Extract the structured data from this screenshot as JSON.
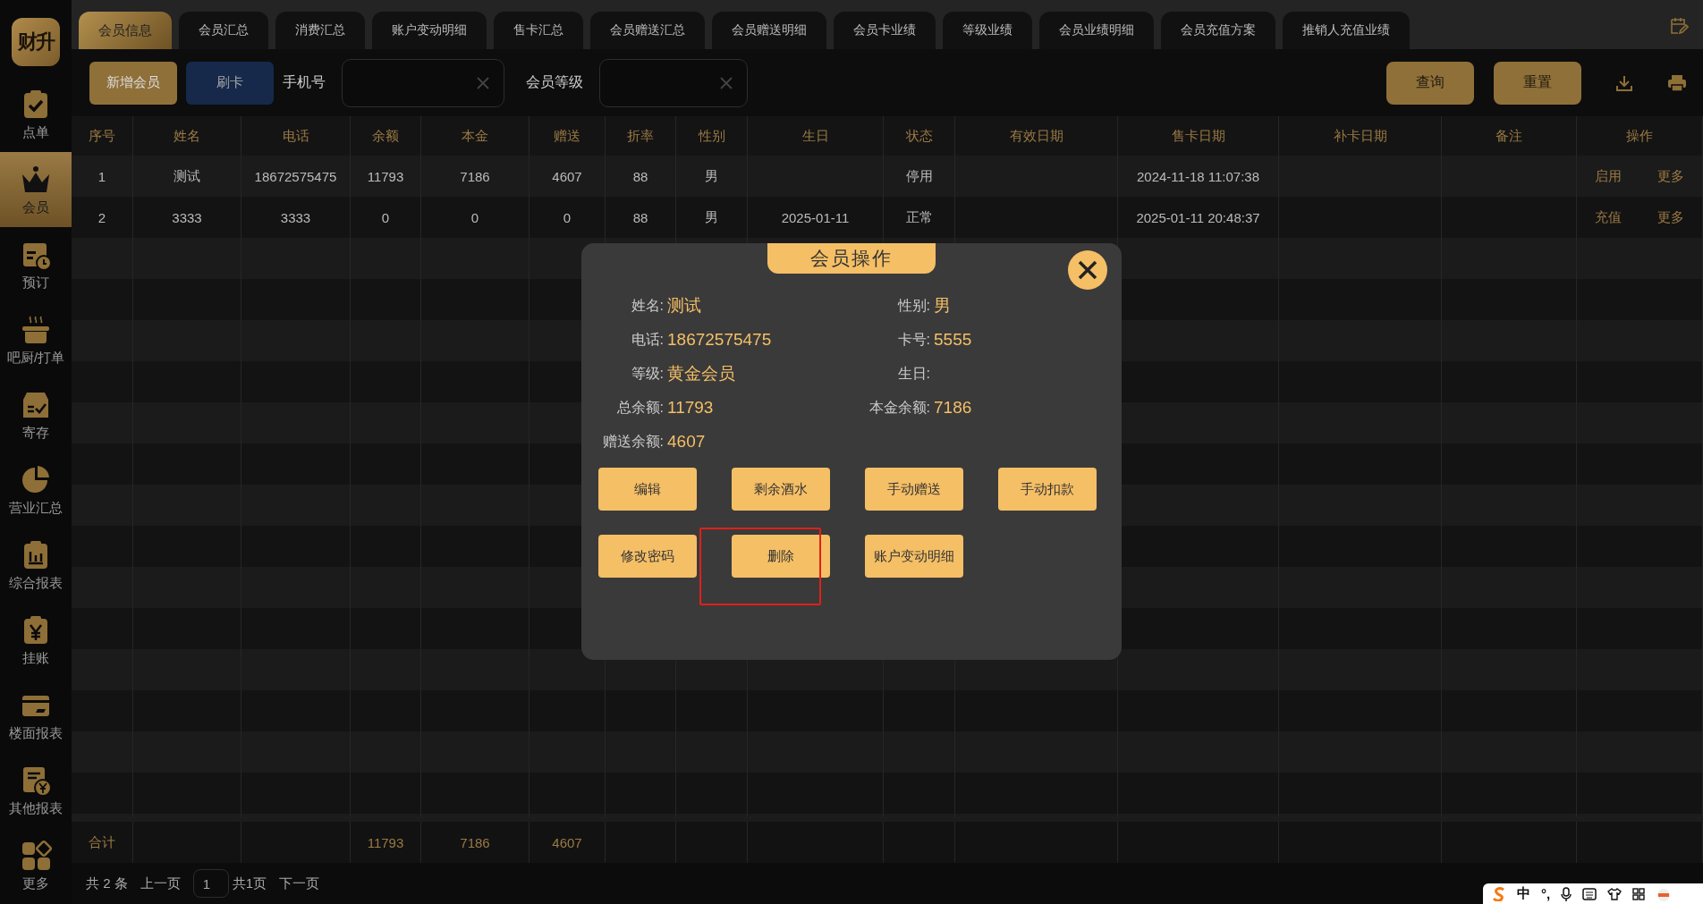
{
  "logo": "财升",
  "sidebar": {
    "items": [
      {
        "label": "点单",
        "selected": false
      },
      {
        "label": "会员",
        "selected": true
      },
      {
        "label": "预订",
        "selected": false
      },
      {
        "label": "吧厨/打单",
        "selected": false
      },
      {
        "label": "寄存",
        "selected": false
      },
      {
        "label": "营业汇总",
        "selected": false
      },
      {
        "label": "综合报表",
        "selected": false
      },
      {
        "label": "挂账",
        "selected": false
      },
      {
        "label": "楼面报表",
        "selected": false
      },
      {
        "label": "其他报表",
        "selected": false
      },
      {
        "label": "更多",
        "selected": false
      }
    ]
  },
  "tabs": [
    {
      "label": "会员信息",
      "selected": true
    },
    {
      "label": "会员汇总",
      "selected": false
    },
    {
      "label": "消费汇总",
      "selected": false
    },
    {
      "label": "账户变动明细",
      "selected": false
    },
    {
      "label": "售卡汇总",
      "selected": false
    },
    {
      "label": "会员赠送汇总",
      "selected": false
    },
    {
      "label": "会员赠送明细",
      "selected": false
    },
    {
      "label": "会员卡业绩",
      "selected": false
    },
    {
      "label": "等级业绩",
      "selected": false
    },
    {
      "label": "会员业绩明细",
      "selected": false
    },
    {
      "label": "会员充值方案",
      "selected": false
    },
    {
      "label": "推销人充值业绩",
      "selected": false
    }
  ],
  "toolbar": {
    "buttons": [
      {
        "label": "新增会员",
        "kind": "gold"
      },
      {
        "label": "刷卡",
        "kind": "blue"
      }
    ],
    "fields": [
      {
        "label": "手机号"
      },
      {
        "label": "会员等级"
      }
    ],
    "actions": [
      "查询",
      "重置"
    ]
  },
  "table": {
    "columns": [
      "序号",
      "姓名",
      "电话",
      "余额",
      "本金",
      "赠送",
      "折率",
      "性别",
      "生日",
      "状态",
      "有效日期",
      "售卡日期",
      "补卡日期",
      "备注",
      "操作"
    ],
    "rows": [
      {
        "cells": [
          "1",
          "测试",
          "18672575475",
          "11793",
          "7186",
          "4607",
          "88",
          "男",
          null,
          "停用",
          null,
          "2024-11-18 11:07:38",
          null,
          null
        ],
        "actions": [
          "启用",
          "更多"
        ]
      },
      {
        "cells": [
          "2",
          "3333",
          "3333",
          "0",
          "0",
          "0",
          "88",
          "男",
          "2025-01-11",
          "正常",
          null,
          "2025-01-11 20:48:37",
          null,
          null
        ],
        "actions": [
          "充值",
          "更多"
        ]
      }
    ],
    "totals": {
      "label": "合计",
      "balance": "11793",
      "principal": "7186",
      "bonus": "4607"
    }
  },
  "pagination": {
    "count": "共 2 条",
    "prev": "上一页",
    "page": "1",
    "pages": "共1页",
    "next": "下一页"
  },
  "modal": {
    "title": "会员操作",
    "fields": [
      {
        "label": "姓名:",
        "value": "测试"
      },
      {
        "label": "性别:",
        "value": "男"
      },
      {
        "label": "电话:",
        "value": "18672575475"
      },
      {
        "label": "卡号:",
        "value": "5555"
      },
      {
        "label": "等级:",
        "value": "黄金会员"
      },
      {
        "label": "生日:"
      },
      {
        "label": "总余额:",
        "value": "11793"
      },
      {
        "label": "本金余额:",
        "value": "7186"
      },
      {
        "label": "赠送余额:",
        "value": "4607"
      }
    ],
    "buttons": [
      "编辑",
      "剩余酒水",
      "手动赠送",
      "手动扣款",
      "修改密码",
      "删除",
      "账户变动明细"
    ]
  },
  "ime_bar": {
    "items": [
      "中",
      "°,"
    ]
  }
}
